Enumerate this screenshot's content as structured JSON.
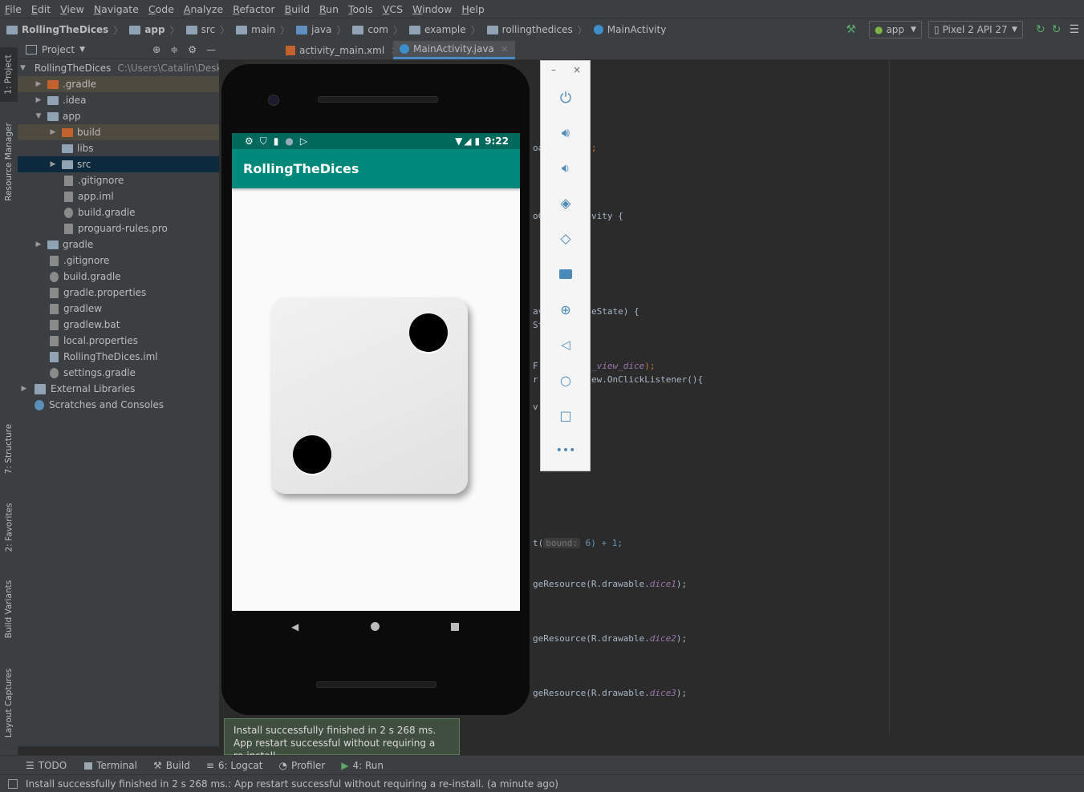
{
  "menu": [
    "File",
    "Edit",
    "View",
    "Navigate",
    "Code",
    "Analyze",
    "Refactor",
    "Build",
    "Run",
    "Tools",
    "VCS",
    "Window",
    "Help"
  ],
  "breadcrumb": [
    "RollingTheDices",
    "app",
    "src",
    "main",
    "java",
    "com",
    "example",
    "rollingthedices",
    "MainActivity"
  ],
  "toolbar": {
    "config": "app",
    "device": "Pixel 2 API 27"
  },
  "left_tabs": [
    "1: Project",
    "Resource Manager",
    "7: Structure",
    "2: Favorites",
    "Build Variants",
    "Layout Captures"
  ],
  "project": {
    "title": "Project",
    "root": "RollingTheDices",
    "root_path": "C:\\Users\\Catalin\\Desktop",
    "items": [
      ".gradle",
      ".idea",
      "app",
      "build",
      "libs",
      "src",
      ".gitignore",
      "app.iml",
      "build.gradle",
      "proguard-rules.pro",
      "gradle",
      ".gitignore",
      "build.gradle",
      "gradle.properties",
      "gradlew",
      "gradlew.bat",
      "local.properties",
      "RollingTheDices.iml",
      "settings.gradle",
      "External Libraries",
      "Scratches and Consoles"
    ]
  },
  "tabs": [
    "activity_main.xml",
    "MainActivity.java"
  ],
  "code": {
    "l1": "oa",
    "l1b": ";",
    "l2": "oC",
    "l2b": "vity {",
    "l3": "av",
    "l3b": "eState) {",
    "l4": "St",
    "l5": "F",
    "l5b": "_view_dice",
    "l5c": ");",
    "l6": "r",
    "l6b": "ew.OnClickListener(){",
    "l7": "v",
    "l8": "t(",
    "l8hint": "bound:",
    "l8c": "6) + 1;",
    "l9": "geResource(R.drawable.",
    "l9b": "dice1",
    "l9c": ");",
    "l10b": "dice2",
    "l11b": "dice3"
  },
  "emulator": {
    "time": "9:22",
    "app_title": "RollingTheDices",
    "dice_pips": 2
  },
  "bottom_tabs": [
    "TODO",
    "Terminal",
    "Build",
    "6: Logcat",
    "Profiler",
    "4: Run"
  ],
  "toast": {
    "line1": "Install successfully finished in 2 s 268 ms.",
    "line2": "App restart successful without requiring a re-install."
  },
  "status": "Install successfully finished in 2 s 268 ms.: App restart successful without requiring a re-install. (a minute ago)",
  "colors": {
    "accent": "#00897b",
    "statusbar": "#00695c",
    "ide_bg": "#2b2b2b",
    "panel": "#3c3f41"
  }
}
